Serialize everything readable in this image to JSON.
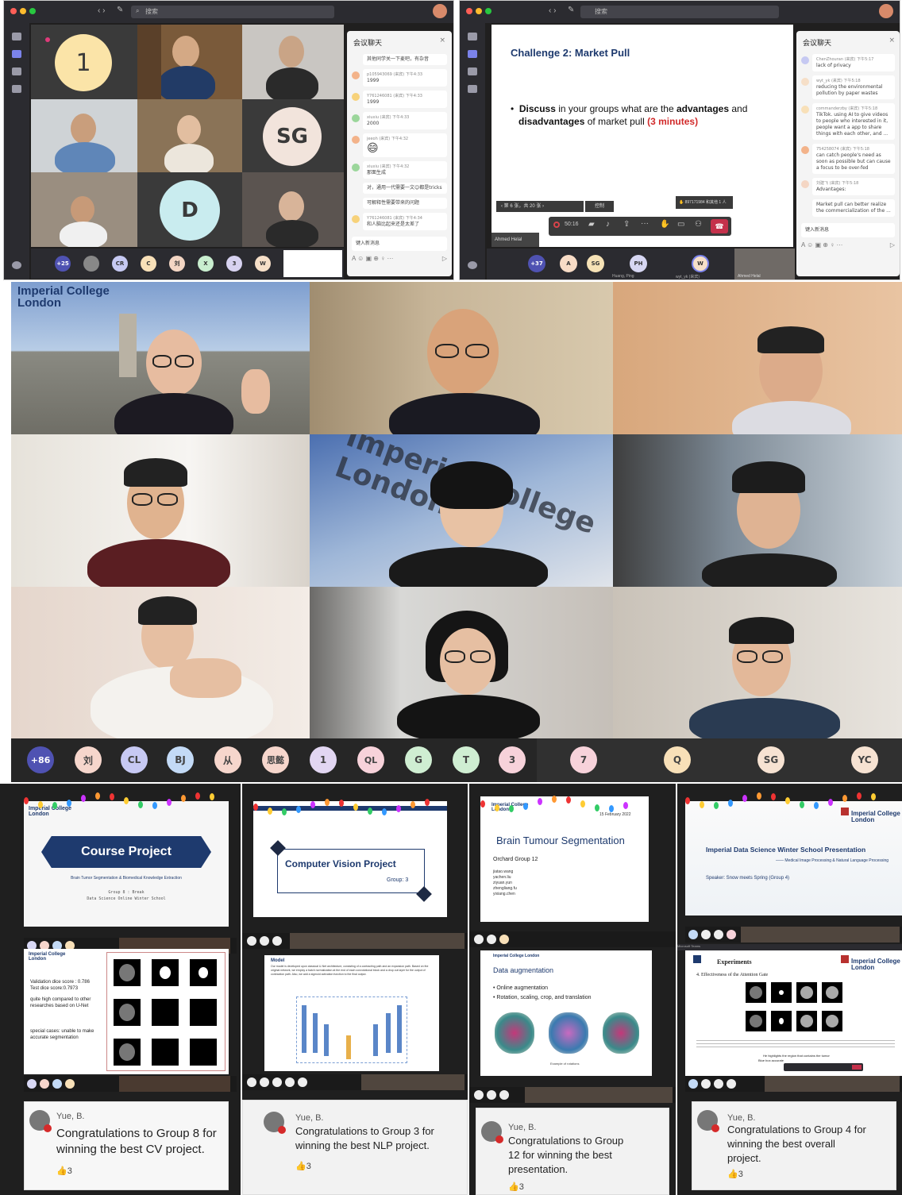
{
  "teams_left": {
    "search": "搜索",
    "chat_title": "会议聊天",
    "tile_number": "1",
    "tile_sg": "SG",
    "tile_d": "D",
    "messages": [
      {
        "name": "",
        "text": "其他同学关一下麦吧，有杂音"
      },
      {
        "name": "p105943069 (来宾)  下午4:33",
        "text": "1999"
      },
      {
        "name": "Y761246081 (来宾)  下午4:33",
        "text": "1999"
      },
      {
        "name": "xiuxiu (来宾)  下午4:33",
        "text": "2000"
      },
      {
        "name": "jeeoh (来宾)  下午4:32",
        "text": "😄"
      },
      {
        "name": "xiuxiu (来宾)  下午4:32",
        "text": "那面生成"
      },
      {
        "name": "",
        "text": "对，通用一代需要一文😊都是tricks"
      },
      {
        "name": "",
        "text": "可解释性需要带来的问题"
      },
      {
        "name": "Y761246081 (来宾)  下午4:34",
        "text": "和人脑比起来还是太差了"
      }
    ],
    "input": "键入新消息",
    "roster": [
      "+25",
      "CR",
      "C",
      "刘",
      "X",
      "3",
      "W"
    ]
  },
  "teams_right": {
    "search": "搜索",
    "slide_title": "Challenge 2: Market Pull",
    "slide_bullet_1": "Discuss",
    "slide_bullet_2": " in your groups what are the ",
    "slide_bullet_3": "advantages",
    "slide_bullet_4": " and",
    "slide_bullet_5": "disadvantages",
    "slide_bullet_6": " of market pull ",
    "slide_bullet_7": "(3 minutes)",
    "slide_nav": "第 6 张，共 20 张",
    "present_btn": "控制",
    "raise_hand": "897171984 和其他 1 人",
    "timer": "50:16",
    "presenter": "Ahmed Helal",
    "chat_title": "会议聊天",
    "messages": [
      {
        "name": "ChenZhouran (来宾)  下午5:17",
        "text": "lack of privacy"
      },
      {
        "name": "wyt_yk (来宾)  下午5:18",
        "text": "reducing the environmental pollution by paper wastes"
      },
      {
        "name": "commanderzby (来宾)  下午5:18",
        "text": "TikTok. using AI to give videos to people who interested in it, people want a app to share things with each other, and ..."
      },
      {
        "name": "754258074 (来宾)  下午5:18",
        "text": "can catch people's need as soon as possible but can cause a focus to be over-fed"
      },
      {
        "name": "刘建飞 (来宾)  下午5:18",
        "text": "Advantages:"
      },
      {
        "name": "",
        "text": "Market pull can better realize the commercialization of the ..."
      }
    ],
    "input": "键入新消息",
    "roster": [
      "+37",
      "A",
      "SG",
      "PH",
      "W"
    ],
    "roster_names": [
      "Huang, Ping",
      "wyt_yk (来宾)",
      "Ahmed Helal"
    ]
  },
  "gallery": {
    "logo_line1": "Imperial College",
    "logo_line2": "London",
    "wall_sign": "Imperial College London",
    "avatars": [
      "+86",
      "刘",
      "CL",
      "BJ",
      "从",
      "思懿",
      "1",
      "QL",
      "G",
      "T",
      "3",
      "7",
      "Q",
      "SG",
      "YC"
    ]
  },
  "slides": {
    "s1_logo": "Imperial College London",
    "s1_title": "Course Project",
    "s1_sub": "Brain Tumor Segmentation & Biomedical Knowledge Extraction",
    "s1_group": "Group 8 : Break",
    "s1_school": "Data Science Online Winter School",
    "s2_title": "Computer Vision Project",
    "s2_group": "Group:  3",
    "s3_logo": "Imperial College London",
    "s3_date": "15 February 2022",
    "s3_title": "Brain Tumour Segmentation",
    "s3_group": "Orchard Group 12",
    "s3_members": [
      "jiatao.wang",
      "yachen.liu",
      "ziyuan.yun",
      "zhengliang.fu",
      "yixiang.chen"
    ],
    "s4_logo1": "Imperial College",
    "s4_logo2": "London",
    "s4_title": "Imperial Data Science Winter School Presentation",
    "s4_sub": "—— Medical Image Processing & Natural Language Processing",
    "s4_speaker": "Speaker: Snow meets Spring (Group 4)",
    "r1_logo": "Imperial College London",
    "r1_line1": "Validation dice score :  0.786",
    "r1_line2": "Test dice score:0.7973",
    "r1_line3": "quite high compared to other researches based on U-Net",
    "r1_line4": "special cases: unable to make accurate segmentation",
    "r2_title": "Model",
    "r2_text": "Our model is developed upon classical U-Net architecture, consisting of a contracting path and an expansion path. Based on the original network, we employ a batch normalization at the end of each convolutional block and a drop out layer for the output of contraction path. Also, we add a sigmoid activation function to the final output.",
    "r3_logo": "Imperial College London",
    "r3_title": "Data augmentation",
    "r3_b1": "Online augmentation",
    "r3_b2": "Rotation, scaling, crop, and translation",
    "r3_caption": "Example of rotations",
    "r4_app": "Microsoft Teams",
    "r4_title": "Experiments",
    "r4_logo1": "Imperial College",
    "r4_logo2": "London",
    "r4_sub": "4. Effectiveness of the Attention Gate",
    "r4_cap": "He highlights the region that contains the tumor",
    "r4_cap2": "Blue box accurate"
  },
  "cards": [
    {
      "name": "Yue, B.",
      "text": "Congratulations to Group 8 for winning the best CV project.",
      "likes": "3"
    },
    {
      "name": "Yue, B.",
      "text": "Congratulations to Group 3 for winning the best NLP project.",
      "likes": "3"
    },
    {
      "name": "Yue, B.",
      "text": "Congratulations to Group 12 for winning the best presentation.",
      "likes": "3"
    },
    {
      "name": "Yue, B.",
      "text": "Congratulations to Group 4 for winning the best overall project.",
      "likes": "3"
    }
  ],
  "colors": {
    "teams_dark": "#201f1f",
    "accent": "#6264a7",
    "imperial_blue": "#1e3a6e",
    "hangup": "#c4314b"
  }
}
